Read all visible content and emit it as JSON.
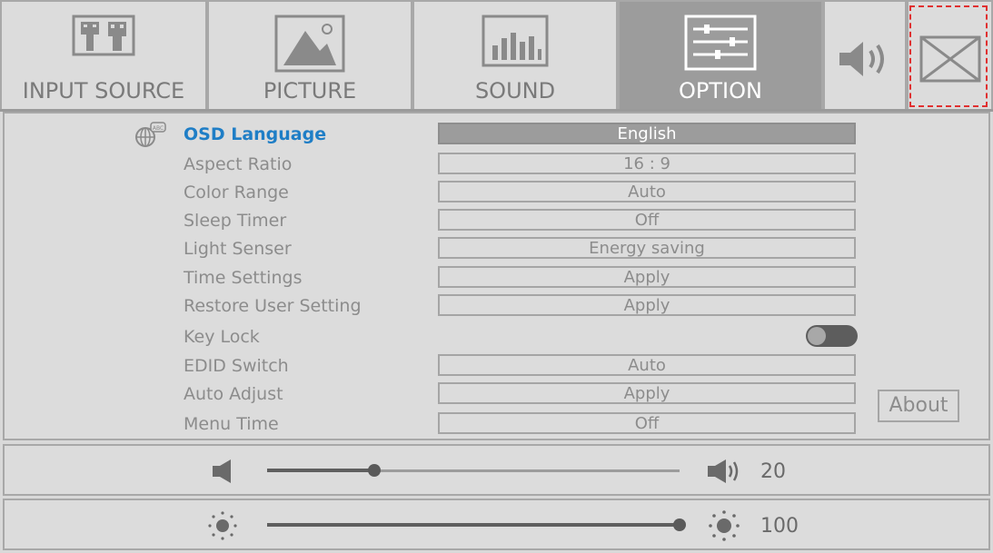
{
  "tabs": [
    {
      "label": "INPUT SOURCE",
      "icon": "input-source-icon"
    },
    {
      "label": "PICTURE",
      "icon": "picture-icon"
    },
    {
      "label": "SOUND",
      "icon": "sound-icon"
    },
    {
      "label": "OPTION",
      "icon": "option-sliders-icon",
      "active": true
    }
  ],
  "options": [
    {
      "name": "OSD  Language",
      "value": "English",
      "selected": true
    },
    {
      "name": "Aspect  Ratio",
      "value": "16 : 9"
    },
    {
      "name": "Color  Range",
      "value": "Auto"
    },
    {
      "name": "Sleep  Timer",
      "value": "Off"
    },
    {
      "name": "Light  Senser",
      "value": "Energy saving"
    },
    {
      "name": "Time  Settings",
      "value": "Apply"
    },
    {
      "name": "Restore  User  Setting",
      "value": "Apply"
    },
    {
      "name": "Key  Lock",
      "value": "",
      "toggle": "on"
    },
    {
      "name": "EDID  Switch",
      "value": "Auto"
    },
    {
      "name": "Auto  Adjust",
      "value": "Apply"
    },
    {
      "name": "Menu  Time",
      "value": "Off"
    }
  ],
  "about_label": "About",
  "volume": {
    "value": "20",
    "fraction": 0.26
  },
  "brightness": {
    "value": "100",
    "fraction": 1.0
  },
  "colors": {
    "accent": "#1f7ec6",
    "active_tab": "#9c9c9c",
    "close_border": "#e03030"
  }
}
